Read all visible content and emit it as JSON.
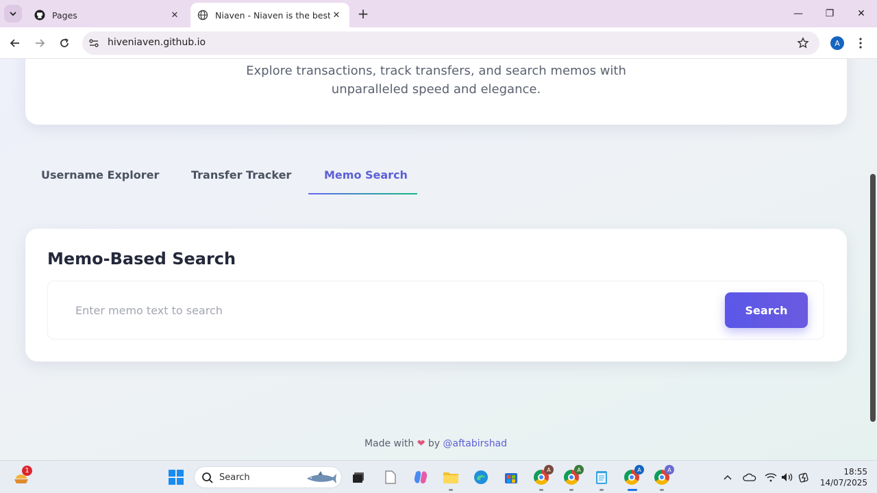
{
  "browser": {
    "tabs": [
      {
        "title": "Pages",
        "icon": "github-icon",
        "active": false
      },
      {
        "title": "Niaven - Niaven is the best plat",
        "icon": "globe-icon",
        "active": true
      }
    ],
    "url": "hiveniaven.github.io",
    "profile_initial": "A"
  },
  "page": {
    "hero_subtitle_line1": "Explore transactions, track transfers, and search memos with",
    "hero_subtitle_line2": "unparalleled speed and elegance.",
    "tabs": [
      {
        "label": "Username Explorer",
        "active": false
      },
      {
        "label": "Transfer Tracker",
        "active": false
      },
      {
        "label": "Memo Search",
        "active": true
      }
    ],
    "memo_search": {
      "title": "Memo-Based Search",
      "placeholder": "Enter memo text to search",
      "button_label": "Search"
    },
    "footer": {
      "prefix": "Made with",
      "heart": "❤",
      "by": "by",
      "author": "@aftabirshad"
    }
  },
  "taskbar": {
    "weather_badge": "1",
    "search_label": "Search",
    "chrome_badges": [
      "A",
      "A",
      "A",
      "A"
    ],
    "time": "18:55",
    "date": "14/07/2025"
  }
}
